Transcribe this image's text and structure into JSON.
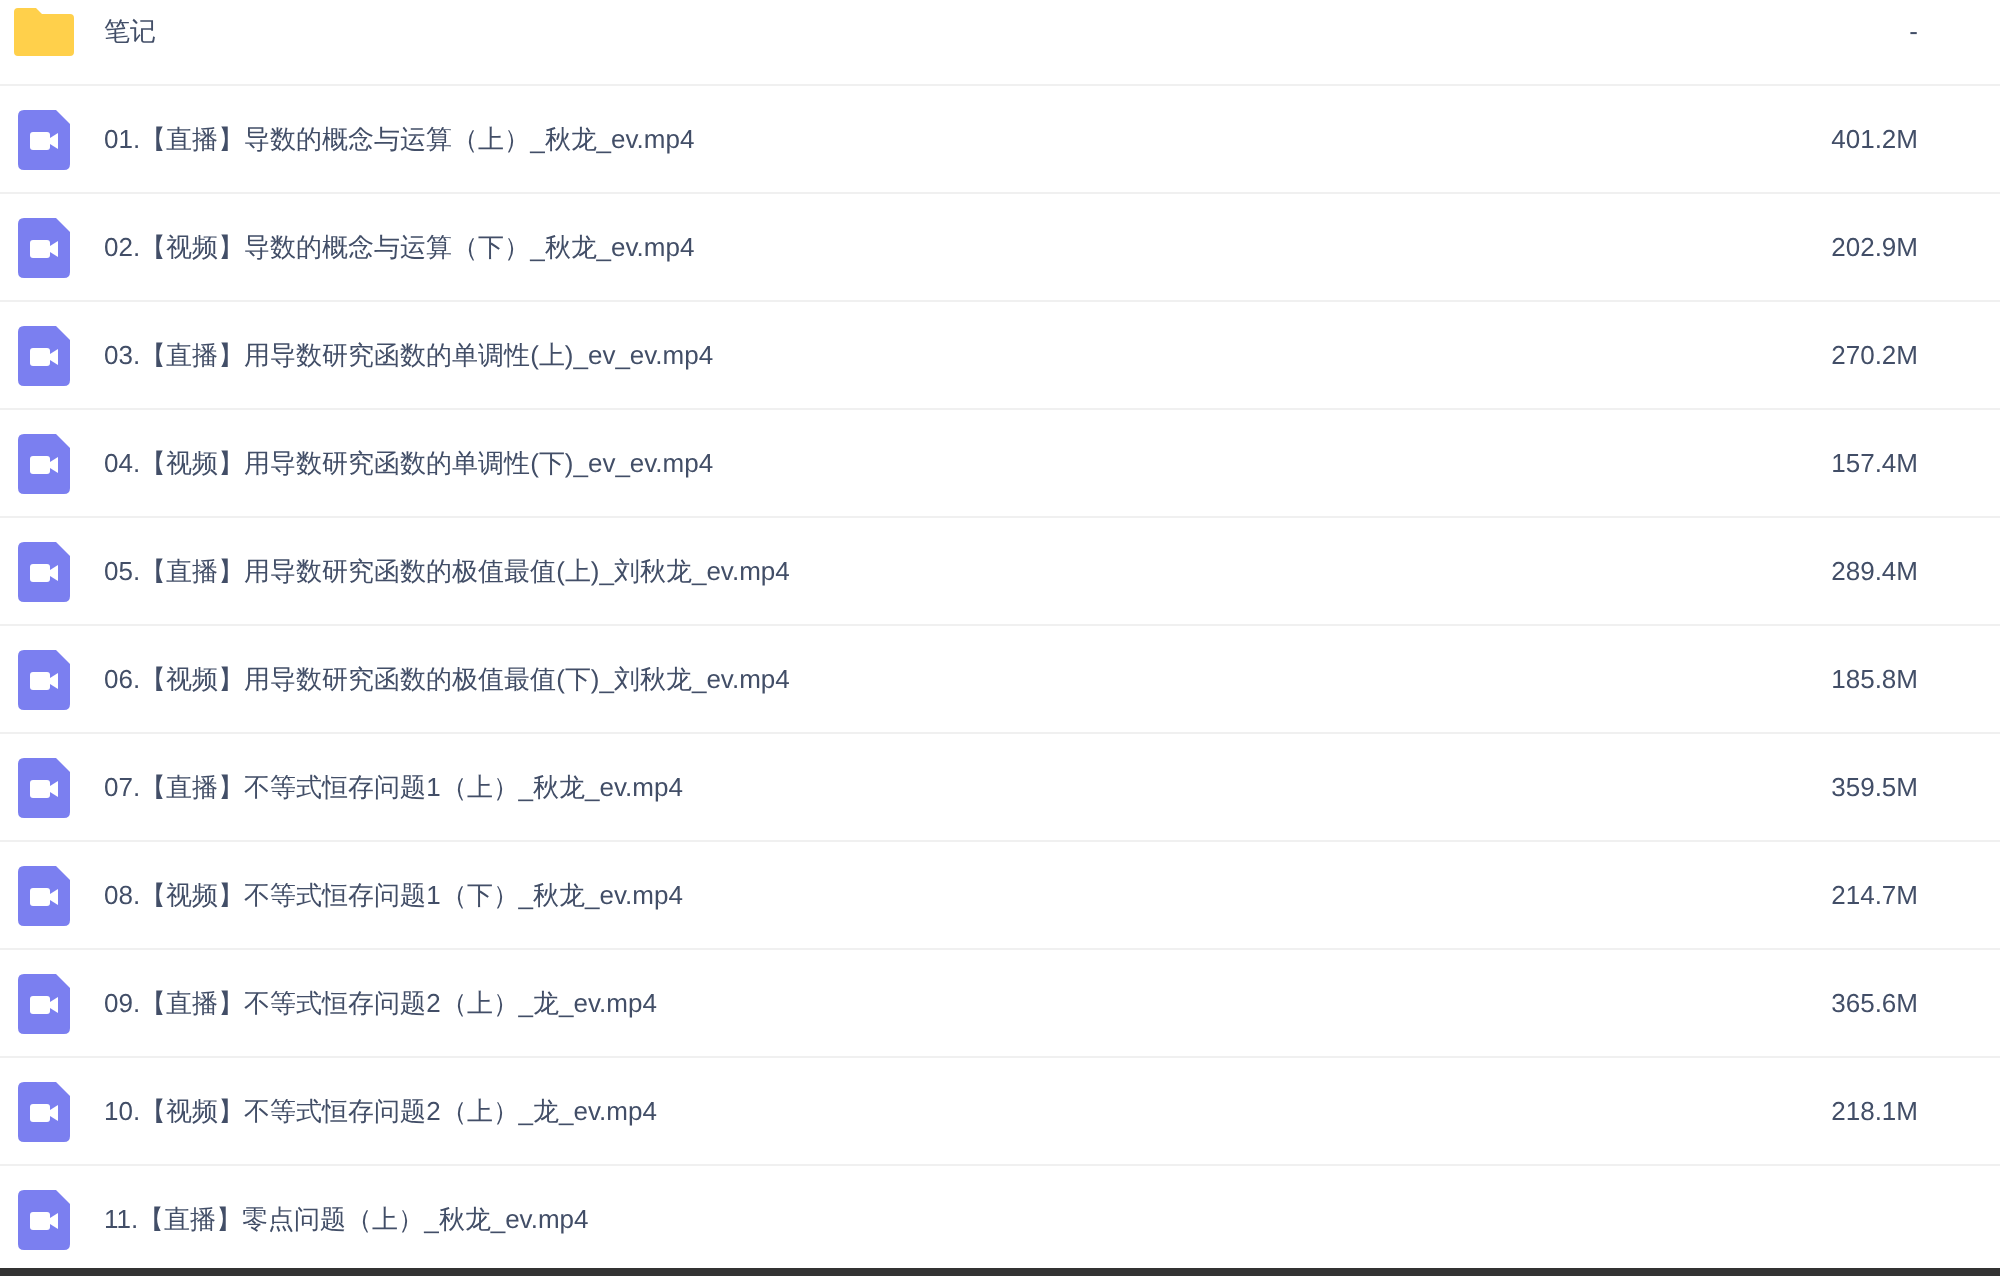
{
  "files": [
    {
      "kind": "folder",
      "name": "笔记",
      "size": "-"
    },
    {
      "kind": "video",
      "name": "01.【直播】导数的概念与运算（上）_秋龙_ev.mp4",
      "size": "401.2M"
    },
    {
      "kind": "video",
      "name": "02.【视频】导数的概念与运算（下）_秋龙_ev.mp4",
      "size": "202.9M"
    },
    {
      "kind": "video",
      "name": "03.【直播】用导数研究函数的单调性(上)_ev_ev.mp4",
      "size": "270.2M"
    },
    {
      "kind": "video",
      "name": "04.【视频】用导数研究函数的单调性(下)_ev_ev.mp4",
      "size": "157.4M"
    },
    {
      "kind": "video",
      "name": "05.【直播】用导数研究函数的极值最值(上)_刘秋龙_ev.mp4",
      "size": "289.4M"
    },
    {
      "kind": "video",
      "name": "06.【视频】用导数研究函数的极值最值(下)_刘秋龙_ev.mp4",
      "size": "185.8M"
    },
    {
      "kind": "video",
      "name": "07.【直播】不等式恒存问题1（上）_秋龙_ev.mp4",
      "size": "359.5M"
    },
    {
      "kind": "video",
      "name": "08.【视频】不等式恒存问题1（下）_秋龙_ev.mp4",
      "size": "214.7M"
    },
    {
      "kind": "video",
      "name": "09.【直播】不等式恒存问题2（上）_龙_ev.mp4",
      "size": "365.6M"
    },
    {
      "kind": "video",
      "name": "10.【视频】不等式恒存问题2（上）_龙_ev.mp4",
      "size": "218.1M"
    },
    {
      "kind": "video",
      "name": "11.【直播】零点问题（上）_秋龙_ev.mp4"
    }
  ]
}
